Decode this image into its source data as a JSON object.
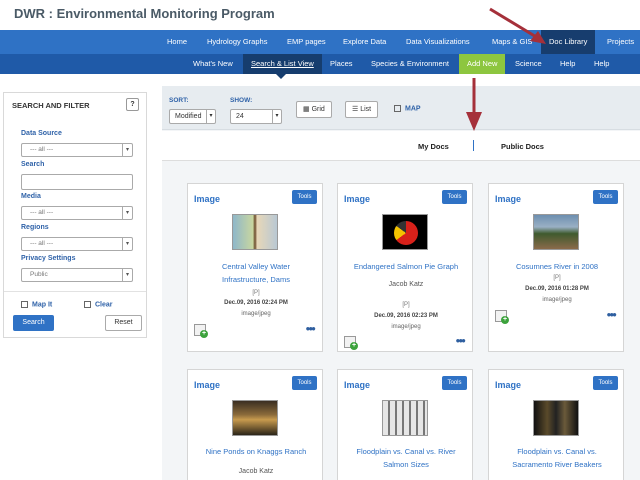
{
  "site": {
    "title": "DWR : Environmental Monitoring Program"
  },
  "nav_primary": [
    "Home",
    "Hydrology Graphs",
    "EMP pages",
    "Explore Data",
    "Data Visualizations",
    "Maps & GIS",
    "Doc Library",
    "Projects"
  ],
  "nav_secondary": [
    "What's New",
    "Search & List View",
    "Places",
    "Species & Environment",
    "Add New",
    "Science",
    "Help",
    "Help"
  ],
  "sidebar": {
    "title": "SEARCH AND FILTER",
    "help": "?",
    "data_source_label": "Data Source",
    "data_source_value": "--- all ---",
    "search_label": "Search",
    "media_label": "Media",
    "media_value": "--- all ---",
    "regions_label": "Regions",
    "regions_value": "--- all ---",
    "privacy_label": "Privacy Settings",
    "privacy_value": "Public",
    "map_it": "Map It",
    "clear": "Clear",
    "search_button": "Search",
    "reset_button": "Reset"
  },
  "toolbar": {
    "sort_label": "SORT:",
    "sort_value": "Modified",
    "show_label": "SHOW:",
    "show_value": "24",
    "grid": "Grid",
    "list": "List",
    "map": "MAP"
  },
  "tabs": {
    "my_docs": "My Docs",
    "public_docs": "Public Docs"
  },
  "cards": [
    {
      "type": "Image",
      "tools": "Tools",
      "title_lines": [
        "Central Valley Water",
        "Infrastructure, Dams"
      ],
      "author": "",
      "flag": "[P]",
      "date": "Dec.09, 2016 02:24 PM",
      "mime": "image/jpeg"
    },
    {
      "type": "Image",
      "tools": "Tools",
      "title_lines": [
        "Endangered Salmon Pie Graph"
      ],
      "author": "Jacob Katz",
      "flag": "[P]",
      "date": "Dec.09, 2016 02:23 PM",
      "mime": "image/jpeg"
    },
    {
      "type": "Image",
      "tools": "Tools",
      "title_lines": [
        "Cosumnes River in 2008"
      ],
      "author": "",
      "flag": "[P]",
      "date": "Dec.09, 2016 01:28 PM",
      "mime": "image/jpeg"
    },
    {
      "type": "Image",
      "tools": "Tools",
      "title_lines": [
        "Nine Ponds on Knaggs Ranch"
      ],
      "author": "Jacob Katz",
      "flag": "",
      "date": "",
      "mime": ""
    },
    {
      "type": "Image",
      "tools": "Tools",
      "title_lines": [
        "Floodplain vs. Canal vs. River",
        "Salmon Sizes"
      ],
      "author": "",
      "flag": "",
      "date": "",
      "mime": ""
    },
    {
      "type": "Image",
      "tools": "Tools",
      "title_lines": [
        "Floodplain vs. Canal vs.",
        "Sacramento River Beakers"
      ],
      "author": "",
      "flag": "",
      "date": "",
      "mime": ""
    }
  ],
  "colors": {
    "nav_primary": "#2f72c5",
    "nav_secondary": "#1f5aa8",
    "active": "#173d6e",
    "add_new": "#8dc63f",
    "arrow": "#a5303a"
  }
}
